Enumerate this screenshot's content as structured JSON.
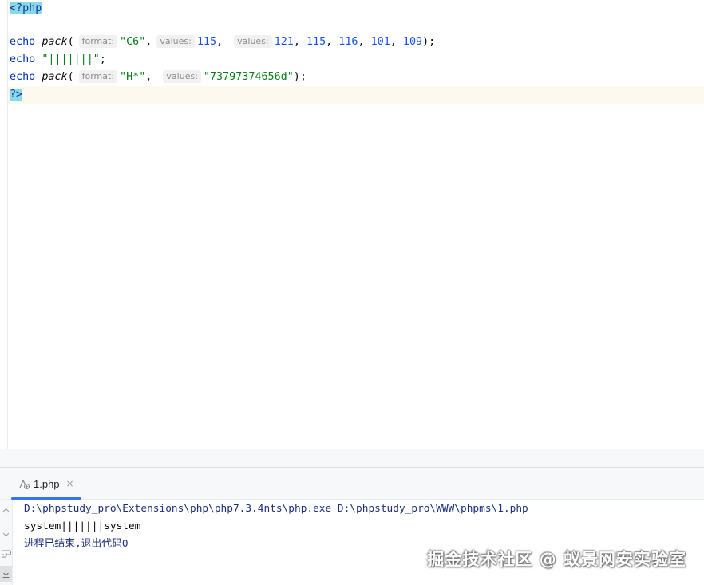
{
  "editor": {
    "line1": {
      "open_tag": "<?php"
    },
    "line3": {
      "kw": "echo",
      "fn": "pack",
      "open": "(",
      "hint_format": "format:",
      "arg_format": "\"C6\"",
      "comma1": ",",
      "hint_values1": "values:",
      "arg_v1": "115",
      "comma2": ",",
      "hint_values2": "values:",
      "arg_v2": "121",
      "sep1": ", ",
      "arg_v3": "115",
      "sep2": ", ",
      "arg_v4": "116",
      "sep3": ", ",
      "arg_v5": "101",
      "sep4": ", ",
      "arg_v6": "109",
      "close": ");"
    },
    "line4": {
      "kw": "echo",
      "str": "\"|||||||\"",
      "end": ";"
    },
    "line5": {
      "kw": "echo",
      "fn": "pack",
      "open": "(",
      "hint_format": "format:",
      "arg_format": "\"H*\"",
      "comma1": ",",
      "hint_values": "values:",
      "arg_values": "\"73797374656d\"",
      "close": ");"
    },
    "line6": {
      "close_tag": "?>"
    }
  },
  "run_panel": {
    "tab_label": "1.php",
    "tab_close": "×",
    "console": {
      "command": "D:\\phpstudy_pro\\Extensions\\php\\php7.3.4nts\\php.exe D:\\phpstudy_pro\\WWW\\phpms\\1.php",
      "output": "system|||||||system",
      "exit_message": "进程已结束,退出代码0"
    },
    "gutter_icons": [
      "arrow-up-icon",
      "arrow-down-icon",
      "soft-wrap-icon",
      "scroll-to-end-icon"
    ]
  },
  "watermark": "掘金技术社区 @ 蚁景网安实验室",
  "colors": {
    "keyword": "#0033b3",
    "string": "#067d17",
    "number": "#1750eb",
    "php_tag_bg": "#8ad9e6",
    "current_line_bg": "#fdf9ef",
    "tab_accent": "#3574f0"
  }
}
